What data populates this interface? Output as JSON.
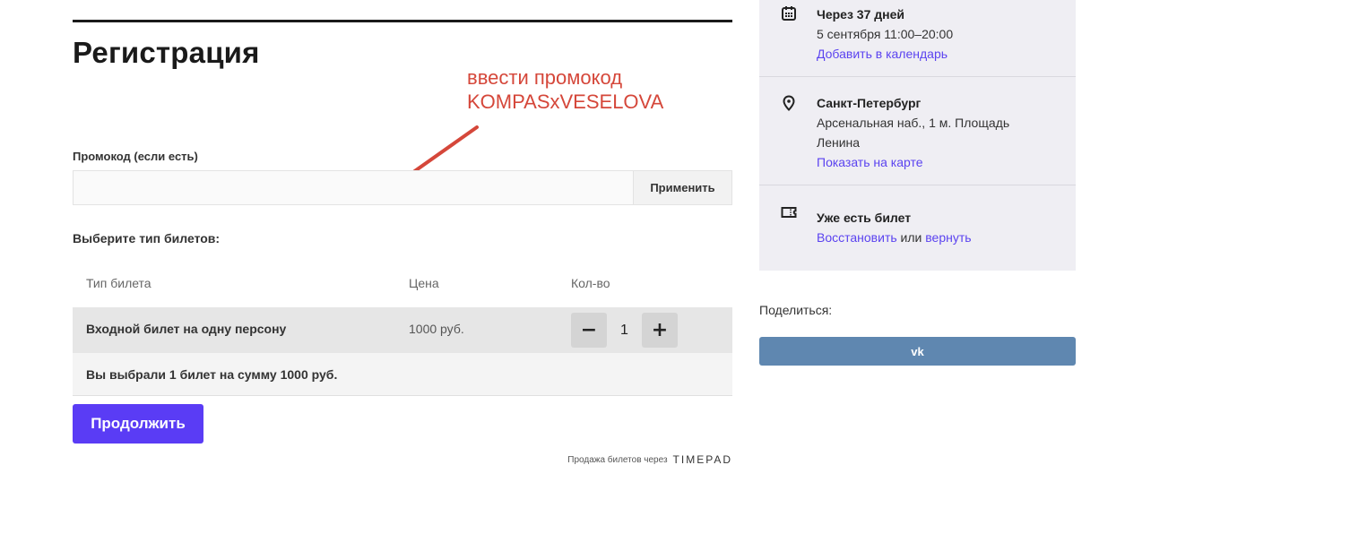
{
  "registration": {
    "title": "Регистрация",
    "promo_label": "Промокод (если есть)",
    "promo_value": "",
    "promo_placeholder": "",
    "apply_label": "Применить",
    "ticket_type_label": "Выберите тип билетов:",
    "table_headers": [
      "Тип билета",
      "Цена",
      "Кол-во"
    ],
    "tickets": [
      {
        "name": "Входной билет на одну персону",
        "price": "1000 руб.",
        "qty": "1"
      }
    ],
    "minus_label": "−",
    "plus_label": "+",
    "summary": "Вы выбрали 1 билет на сумму 1000 руб.",
    "continue_label": "Продолжить",
    "powered_text": "Продажа билетов через",
    "powered_brand": "TIMEPAD"
  },
  "annotation": {
    "line1": "ввести промокод",
    "line2": "KOMPASxVESELOVA",
    "color": "#d5473a"
  },
  "sidebar": {
    "date": {
      "title": "Через 37 дней",
      "detail": "5 сентября 11:00–20:00",
      "link": "Добавить в календарь",
      "icon": "calendar-icon"
    },
    "location": {
      "title": "Санкт-Петербург",
      "address_line1": "Арсенальная наб., 1 м. Площадь",
      "address_line2": "Ленина",
      "link": "Показать на карте",
      "icon": "location-pin-icon"
    },
    "ticket": {
      "title": "Уже есть билет",
      "restore_link": "Восстановить",
      "or_text": "или",
      "return_link": "вернуть",
      "icon": "ticket-icon"
    }
  },
  "share": {
    "label": "Поделиться:",
    "vk_label": "vk",
    "vk_color": "#5f87b0"
  },
  "colors": {
    "accent": "#5a3cf5",
    "link": "#5b43f0",
    "sidebar_bg": "#efeef3"
  }
}
